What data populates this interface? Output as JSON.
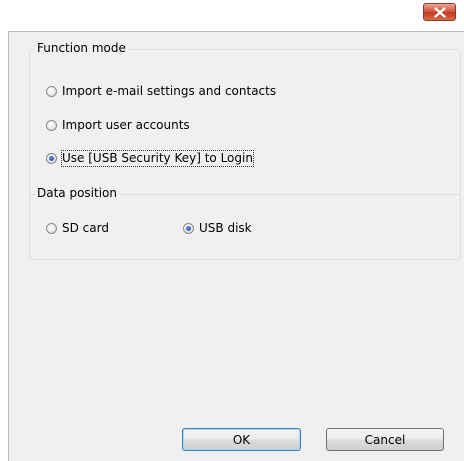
{
  "window": {
    "title": "",
    "close_icon": "close-x-icon",
    "close_color": "#c7432b"
  },
  "function_mode": {
    "title": "Function mode",
    "options": [
      {
        "label": "Import e-mail settings and contacts",
        "checked": false
      },
      {
        "label": "Import user accounts",
        "checked": false
      },
      {
        "label": "Use [USB Security Key] to Login",
        "checked": true
      }
    ]
  },
  "data_position": {
    "title": "Data position",
    "options": [
      {
        "label": "SD card",
        "checked": false
      },
      {
        "label": "USB disk",
        "checked": true
      }
    ]
  },
  "buttons": {
    "ok_label": "OK",
    "cancel_label": "Cancel"
  }
}
